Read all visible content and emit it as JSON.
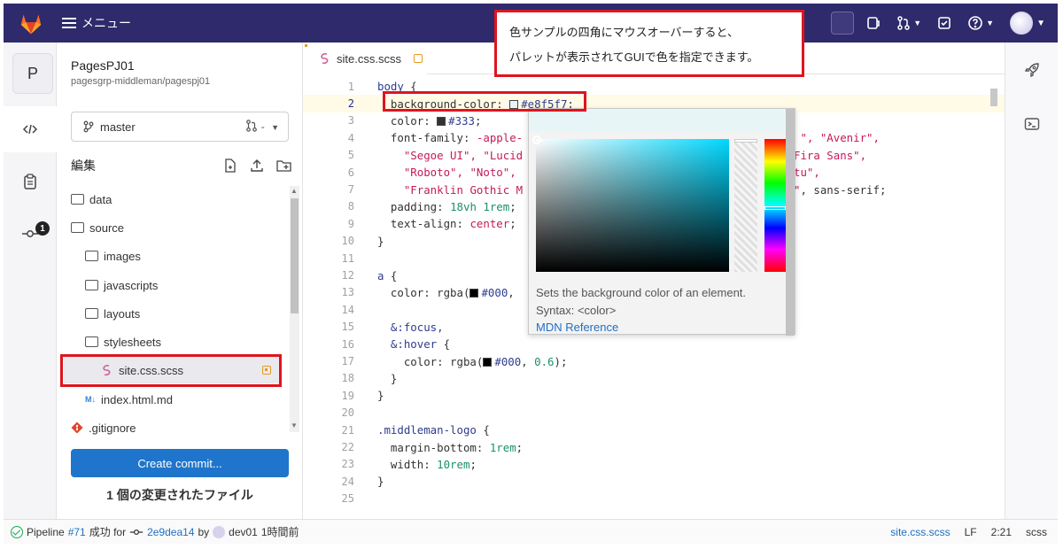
{
  "topbar": {
    "menu_label": "メニュー"
  },
  "callout": {
    "line1": "色サンプルの四角にマウスオーバーすると、",
    "line2": "パレットが表示されてGUIで色を指定できます。"
  },
  "project": {
    "avatar_letter": "P",
    "name": "PagesPJ01",
    "path": "pagesgrp-middleman/pagespj01"
  },
  "branch": {
    "name": "master",
    "mr_label": "-"
  },
  "tree": {
    "header_label": "編集",
    "items": [
      {
        "label": "data",
        "kind": "folder",
        "indent": 0
      },
      {
        "label": "source",
        "kind": "folder",
        "indent": 0
      },
      {
        "label": "images",
        "kind": "folder",
        "indent": 1
      },
      {
        "label": "javascripts",
        "kind": "folder",
        "indent": 1
      },
      {
        "label": "layouts",
        "kind": "folder",
        "indent": 1
      },
      {
        "label": "stylesheets",
        "kind": "folder",
        "indent": 1
      },
      {
        "label": "site.css.scss",
        "kind": "scss",
        "indent": 2
      },
      {
        "label": "index.html.md",
        "kind": "md",
        "indent": 1
      },
      {
        "label": ".gitignore",
        "kind": "git",
        "indent": 0
      }
    ],
    "md_badge": "M↓"
  },
  "commit": {
    "button_label": "Create commit...",
    "changed_label": "1 個の変更されたファイル"
  },
  "editor": {
    "tab_label": "site.css.scss",
    "lines": [
      {
        "n": "1",
        "html": "<span class='kw'>body</span> {"
      },
      {
        "n": "2",
        "html": "  background-color: <span class='sw' style='background:#e8f5f7'></span><span class='hex'>#e8f5f7</span>;"
      },
      {
        "n": "3",
        "html": "  color: <span class='sw' style='background:#333'></span><span class='hex'>#333</span>;"
      },
      {
        "n": "4",
        "html": "  font-family: <span class='str'>-apple-</span>                                          <span class='str'>\", \"Avenir\",</span>"
      },
      {
        "n": "5",
        "html": "    <span class='str'>\"Segoe UI\", \"Lucid</span>                                      <span class='str'>, \"Fira Sans\",</span>"
      },
      {
        "n": "6",
        "html": "    <span class='str'>\"Roboto\", \"Noto\",</span>                                       <span class='str'>buntu\",</span>"
      },
      {
        "n": "7",
        "html": "    <span class='str'>\"Franklin Gothic M</span>                                      <span class='str'>ans\"</span>, sans-serif;"
      },
      {
        "n": "8",
        "html": "  padding: <span class='num'>18vh 1rem</span>;"
      },
      {
        "n": "9",
        "html": "  text-align: <span class='str'>center</span>;"
      },
      {
        "n": "10",
        "html": "}"
      },
      {
        "n": "11",
        "html": ""
      },
      {
        "n": "12",
        "html": "<span class='kw'>a</span> {"
      },
      {
        "n": "13",
        "html": "  color: rgba(<span class='sw' style='background:#000'></span><span class='hex'>#000</span>,"
      },
      {
        "n": "14",
        "html": ""
      },
      {
        "n": "15",
        "html": "  <span class='kw'>&amp;:focus,</span>"
      },
      {
        "n": "16",
        "html": "  <span class='kw'>&amp;:hover</span> {"
      },
      {
        "n": "17",
        "html": "    color: rgba(<span class='sw' style='background:#000'></span><span class='hex'>#000</span>, <span class='num'>0.6</span>);"
      },
      {
        "n": "18",
        "html": "  }"
      },
      {
        "n": "19",
        "html": "}"
      },
      {
        "n": "20",
        "html": ""
      },
      {
        "n": "21",
        "html": "<span class='kw'>.middleman-logo</span> {"
      },
      {
        "n": "22",
        "html": "  margin-bottom: <span class='num'>1rem</span>;"
      },
      {
        "n": "23",
        "html": "  width: <span class='num'>10rem</span>;"
      },
      {
        "n": "24",
        "html": "}"
      },
      {
        "n": "25",
        "html": ""
      }
    ]
  },
  "picker": {
    "description": "Sets the background color of an element.",
    "syntax": "Syntax: <color>",
    "mdn_link": "MDN Reference"
  },
  "status": {
    "pipeline_label": "Pipeline",
    "pipeline_id": "#71",
    "pipeline_result": "成功 for",
    "commit_sha": "2e9dea14",
    "by": "by",
    "user": "dev01",
    "time": "1時間前",
    "file": "site.css.scss",
    "eol": "LF",
    "position": "2:21",
    "lang": "scss"
  },
  "colors": {
    "navbar": "#2f2a6b",
    "primary": "#1f75cb",
    "highlight_red": "#e0141d",
    "modified": "#e79a21",
    "sample_color": "#e8f5f7"
  }
}
